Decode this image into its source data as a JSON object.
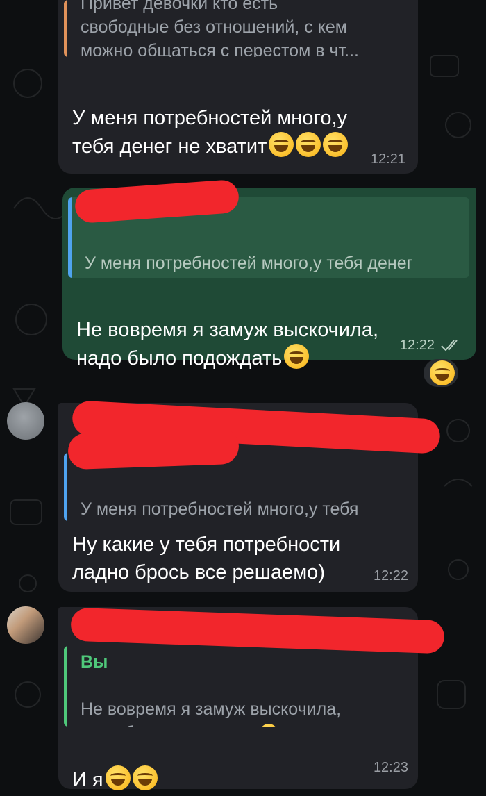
{
  "messages": [
    {
      "quote_text": "Привет девочки кто есть\nсвободные без отношений, с кем\nможно общаться с перестом в чт...",
      "quote_color": "#e0925a",
      "text": "У меня потребностей много,у\nтебя денег не хватит",
      "emojis": "😆😆😆",
      "time": "12:21"
    },
    {
      "quote_text": "У меня потребностей много,у тебя денег\nне хватит",
      "quote_emojis": "😆😆😆",
      "quote_color": "#4fa3ef",
      "text": "Не вовремя я замуж выскочила,\nнадо было подождать",
      "emojis": "😂",
      "time": "12:22",
      "status": "read-double-check",
      "reaction": "😂"
    },
    {
      "quote_text": "У меня потребностей много,у тебя\nденег не хватит",
      "quote_emojis": "😆😆😆",
      "quote_color": "#4fa3ef",
      "text": "Ну какие у тебя потребности\nладно брось все решаемо)",
      "time": "12:22"
    },
    {
      "quote_author": "Вы",
      "quote_text": "Не вовремя я замуж выскочила,\nнадо было подождать",
      "quote_emojis": "😂",
      "quote_color": "#4fc87a",
      "text": "И я",
      "emojis": "🤣🤭",
      "time": "12:23"
    }
  ],
  "colors": {
    "incoming_bubble": "#212227",
    "outgoing_bubble": "#1f4a36",
    "redaction": "#f2262c"
  }
}
